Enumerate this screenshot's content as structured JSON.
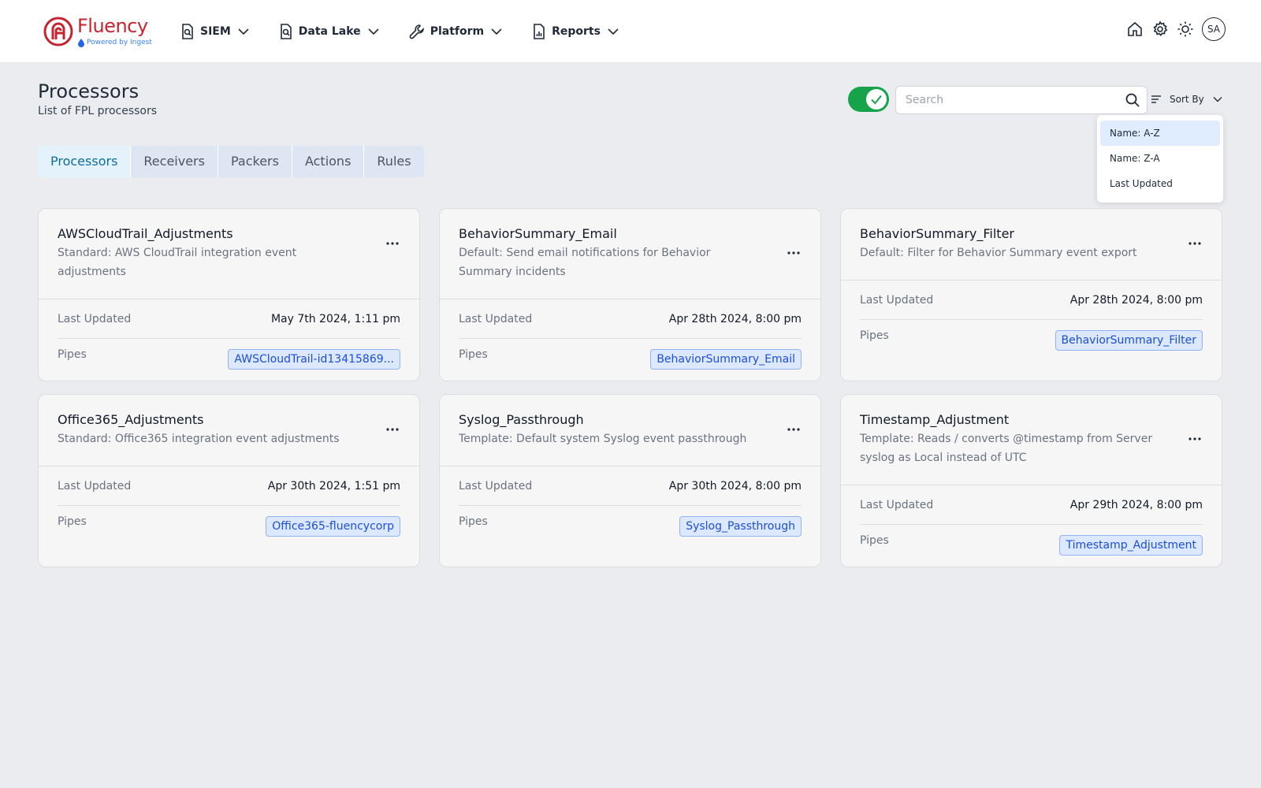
{
  "brand": {
    "name": "Fluency",
    "tagline": "Powered by Ingest",
    "color": "#c8242f"
  },
  "nav": [
    {
      "label": "SIEM",
      "icon": "search-doc-icon"
    },
    {
      "label": "Data Lake",
      "icon": "search-doc-icon"
    },
    {
      "label": "Platform",
      "icon": "wrench-icon"
    },
    {
      "label": "Reports",
      "icon": "report-icon"
    }
  ],
  "user": {
    "initials": "SA"
  },
  "page": {
    "title": "Processors",
    "subtitle": "List of FPL processors"
  },
  "toolbar": {
    "toggle_on": true,
    "toggle_color": "#16a34a",
    "search_placeholder": "Search",
    "search_value": "",
    "sort_label": "Sort By"
  },
  "sort_options": [
    {
      "label": "Name: A-Z",
      "selected": true
    },
    {
      "label": "Name: Z-A",
      "selected": false
    },
    {
      "label": "Last Updated",
      "selected": false
    }
  ],
  "tabs": [
    {
      "label": "Processors",
      "active": true
    },
    {
      "label": "Receivers",
      "active": false
    },
    {
      "label": "Packers",
      "active": false
    },
    {
      "label": "Actions",
      "active": false
    },
    {
      "label": "Rules",
      "active": false
    }
  ],
  "labels": {
    "last_updated": "Last Updated",
    "pipes": "Pipes"
  },
  "cards": [
    {
      "title": "AWSCloudTrail_Adjustments",
      "description": "Standard: AWS CloudTrail integration event adjustments",
      "last_updated": "May 7th 2024, 1:11 pm",
      "pipe": "AWSCloudTrail-id13415869..."
    },
    {
      "title": "BehaviorSummary_Email",
      "description": "Default: Send email notifications for Behavior Summary incidents",
      "last_updated": "Apr 28th 2024, 8:00 pm",
      "pipe": "BehaviorSummary_Email"
    },
    {
      "title": "BehaviorSummary_Filter",
      "description": "Default: Filter for Behavior Summary event export",
      "last_updated": "Apr 28th 2024, 8:00 pm",
      "pipe": "BehaviorSummary_Filter"
    },
    {
      "title": "Office365_Adjustments",
      "description": "Standard: Office365 integration event adjustments",
      "last_updated": "Apr 30th 2024, 1:51 pm",
      "pipe": "Office365-fluencycorp"
    },
    {
      "title": "Syslog_Passthrough",
      "description": "Template: Default system Syslog event passthrough",
      "last_updated": "Apr 30th 2024, 8:00 pm",
      "pipe": "Syslog_Passthrough"
    },
    {
      "title": "Timestamp_Adjustment",
      "description": "Template: Reads / converts @timestamp from Server syslog as Local instead of UTC",
      "last_updated": "Apr 29th 2024, 8:00 pm",
      "pipe": "Timestamp_Adjustment"
    }
  ]
}
